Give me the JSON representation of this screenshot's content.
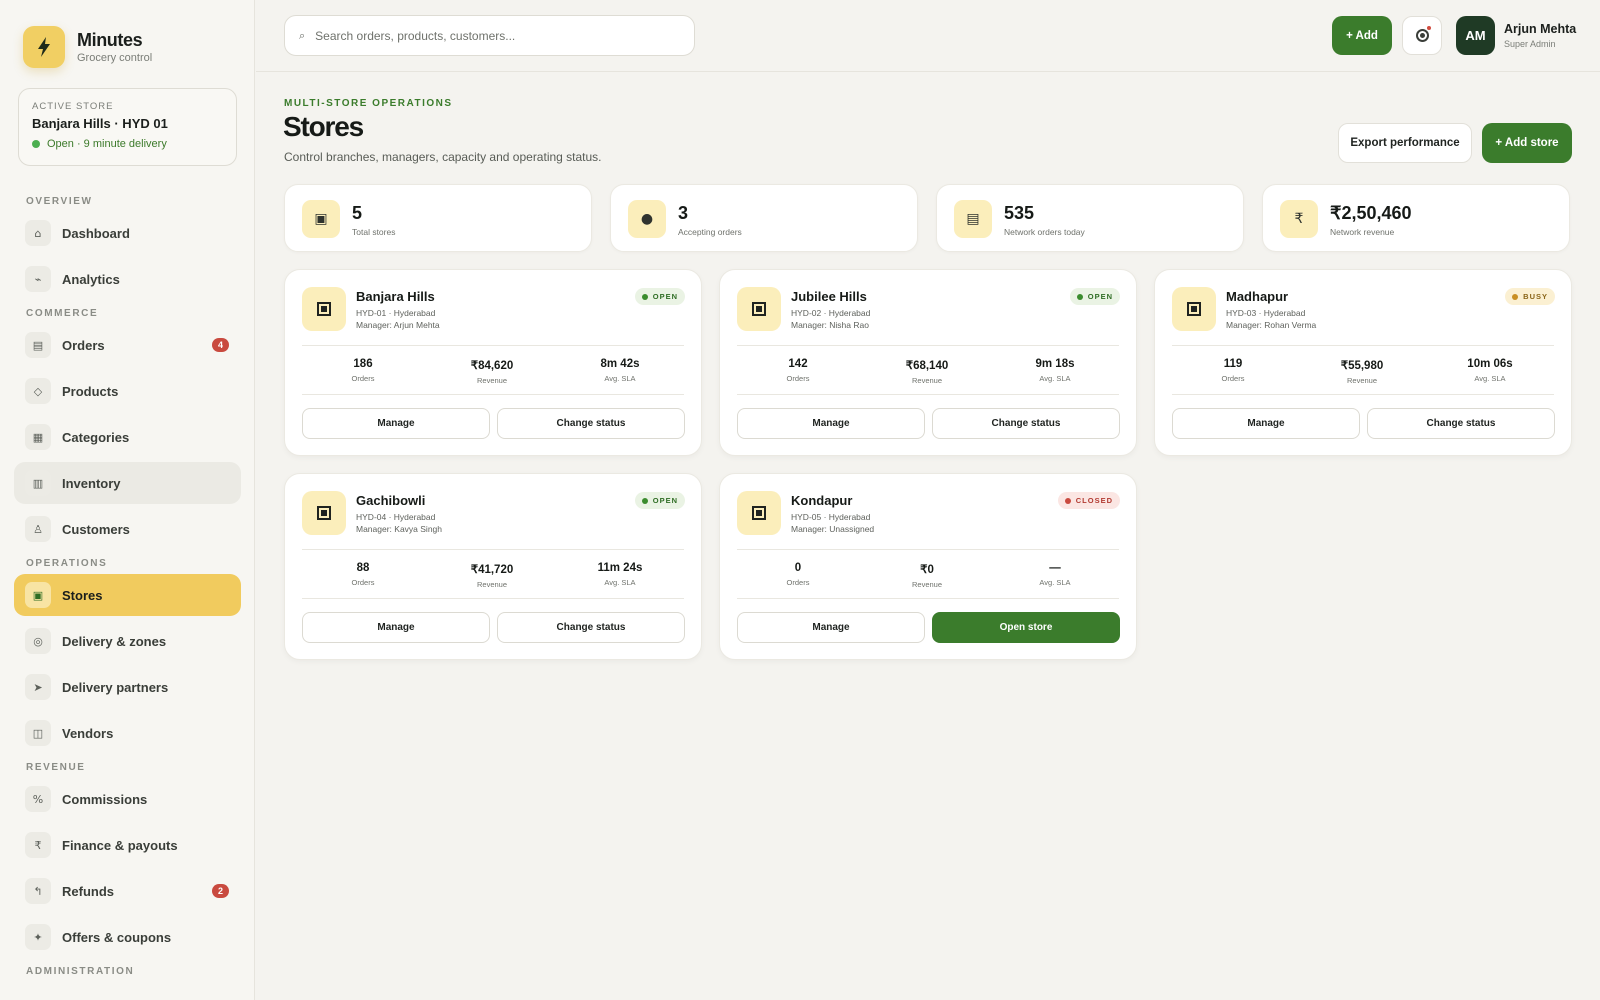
{
  "brand": {
    "name": "Minutes",
    "subtitle": "Grocery control"
  },
  "active_store": {
    "label": "ACTIVE STORE",
    "name": "Banjara Hills · HYD 01",
    "status": "Open · 9 minute delivery"
  },
  "nav": {
    "sections": [
      {
        "title": "OVERVIEW",
        "items": [
          {
            "label": "Dashboard",
            "icon": "home-icon"
          },
          {
            "label": "Analytics",
            "icon": "chart-icon"
          }
        ]
      },
      {
        "title": "COMMERCE",
        "items": [
          {
            "label": "Orders",
            "icon": "orders-icon",
            "badge": "4"
          },
          {
            "label": "Products",
            "icon": "diamond-icon"
          },
          {
            "label": "Categories",
            "icon": "grid-icon"
          },
          {
            "label": "Inventory",
            "icon": "inventory-icon"
          },
          {
            "label": "Customers",
            "icon": "user-icon"
          }
        ]
      },
      {
        "title": "OPERATIONS",
        "items": [
          {
            "label": "Stores",
            "icon": "store-icon"
          },
          {
            "label": "Delivery & zones",
            "icon": "target-icon"
          },
          {
            "label": "Delivery partners",
            "icon": "send-icon"
          },
          {
            "label": "Vendors",
            "icon": "vendor-icon"
          }
        ]
      },
      {
        "title": "REVENUE",
        "items": [
          {
            "label": "Commissions",
            "icon": "percent-icon"
          },
          {
            "label": "Finance & payouts",
            "icon": "rupee-icon"
          },
          {
            "label": "Refunds",
            "icon": "refund-icon",
            "badge": "2"
          },
          {
            "label": "Offers & coupons",
            "icon": "sparkle-icon"
          }
        ]
      },
      {
        "title": "ADMINISTRATION",
        "items": []
      }
    ]
  },
  "topbar": {
    "search_placeholder": "Search orders, products, customers...",
    "add_label": "+ Add",
    "avatar_initials": "AM",
    "user_name": "Arjun Mehta",
    "user_role": "Super Admin"
  },
  "header": {
    "eyebrow": "MULTI-STORE OPERATIONS",
    "title": "Stores",
    "description": "Control branches, managers, capacity and operating status.",
    "export_label": "Export performance",
    "add_store_label": "+ Add store"
  },
  "stats": [
    {
      "value": "5",
      "label": "Total stores",
      "icon": "store-icon",
      "glyph": "▣"
    },
    {
      "value": "3",
      "label": "Accepting orders",
      "icon": "dot-icon",
      "glyph": "●"
    },
    {
      "value": "535",
      "label": "Network orders today",
      "icon": "list-icon",
      "glyph": "▤"
    },
    {
      "value": "₹2,50,460",
      "label": "Network revenue",
      "icon": "rupee-icon",
      "glyph": "₹"
    }
  ],
  "stores": [
    {
      "name": "Banjara Hills",
      "code": "HYD-01 · Hyderabad",
      "manager": "Manager: Arjun Mehta",
      "status": "OPEN",
      "status_kind": "open",
      "orders": "186",
      "revenue": "₹84,620",
      "sla": "8m 42s",
      "btn1": "Manage",
      "btn2": "Change status",
      "btn2_primary": false
    },
    {
      "name": "Jubilee Hills",
      "code": "HYD-02 · Hyderabad",
      "manager": "Manager: Nisha Rao",
      "status": "OPEN",
      "status_kind": "open",
      "orders": "142",
      "revenue": "₹68,140",
      "sla": "9m 18s",
      "btn1": "Manage",
      "btn2": "Change status",
      "btn2_primary": false
    },
    {
      "name": "Madhapur",
      "code": "HYD-03 · Hyderabad",
      "manager": "Manager: Rohan Verma",
      "status": "BUSY",
      "status_kind": "busy",
      "orders": "119",
      "revenue": "₹55,980",
      "sla": "10m 06s",
      "btn1": "Manage",
      "btn2": "Change status",
      "btn2_primary": false
    },
    {
      "name": "Gachibowli",
      "code": "HYD-04 · Hyderabad",
      "manager": "Manager: Kavya Singh",
      "status": "OPEN",
      "status_kind": "open",
      "orders": "88",
      "revenue": "₹41,720",
      "sla": "11m 24s",
      "btn1": "Manage",
      "btn2": "Change status",
      "btn2_primary": false
    },
    {
      "name": "Kondapur",
      "code": "HYD-05 · Hyderabad",
      "manager": "Manager: Unassigned",
      "status": "CLOSED",
      "status_kind": "closed",
      "orders": "0",
      "revenue": "₹0",
      "sla": "—",
      "btn1": "Manage",
      "btn2": "Open store",
      "btn2_primary": true
    }
  ],
  "metric_labels": {
    "orders": "Orders",
    "revenue": "Revenue",
    "sla": "Avg. SLA"
  },
  "colors": {
    "accent": "#3b7c2c",
    "brand_yellow": "#f1cb5e",
    "badge_red": "#c94a3f"
  }
}
